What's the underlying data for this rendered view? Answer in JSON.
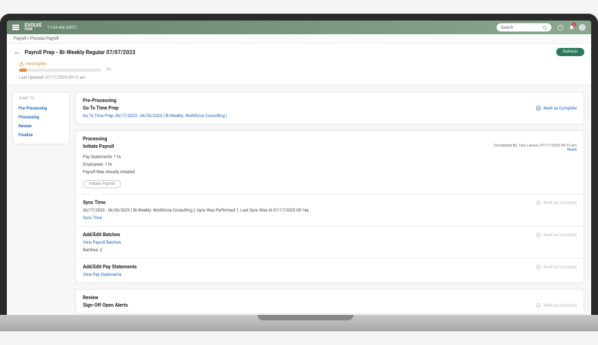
{
  "header": {
    "logo_line1": "EVOLVE",
    "logo_line2": "HCM",
    "time": "11:04 AM (MST)",
    "search_placeholder": "Search",
    "notif_count": "2"
  },
  "breadcrumb": "Payroll > Process Payroll",
  "page": {
    "title": "Payroll Prep - Bi-Weekly Regular 07/07/2023",
    "refresh": "Refresh"
  },
  "status": {
    "label": "Incomplete",
    "percent": "9%",
    "last_updated": "Last Updated: 07/17/2023 09:12 am"
  },
  "sidebar": {
    "jump": "JUMP TO",
    "items": [
      "Pre-Processing",
      "Processing",
      "Review",
      "Finalize"
    ]
  },
  "preprocessing": {
    "heading": "Pre-Processing",
    "sub": "Go To Time Prep",
    "link": "Go To Time Prep: 06/17/2023 - 06/30/2023 ( Bi-Weekly: Workforce Consulting )",
    "mark": "Mark as Complete"
  },
  "processing": {
    "heading": "Processing",
    "initiate": {
      "title": "Initiate Payroll",
      "completed_by": "Completed By: Tara Larson, 07/17/2023 09:12 am",
      "reset": "Reset",
      "line1": "Pay Statements: 116.",
      "line2": "Employees: 116.",
      "line3": "Payroll Was Already Initiated",
      "btn": "Initiate Payroll"
    },
    "sync": {
      "title": "Sync Time",
      "body": "06/17/2023 - 06/30/2023 ( Bi-Weekly: Workforce Consulting ): Sync Was Performed 1. Last Sync Was At 07/17/2023 09:14a",
      "link": "Sync Time",
      "mark": "Mark as Complete"
    },
    "batches": {
      "title": "Add/Edit Batches",
      "link": "View Payroll Batches",
      "body": "Batches: 2",
      "mark": "Mark as Complete"
    },
    "pay": {
      "title": "Add/Edit Pay Statements",
      "link": "View Pay Statements",
      "mark": "Mark as Complete"
    }
  },
  "review": {
    "heading": "Review",
    "sub": "Sign-Off Open Alerts",
    "mark": "Mark as Complete"
  }
}
